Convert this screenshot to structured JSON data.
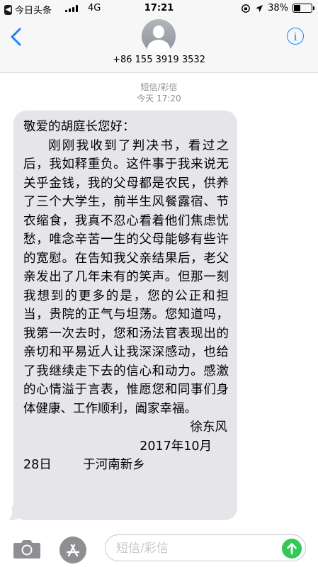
{
  "status_bar": {
    "back_app": "今日头条",
    "network": "4G",
    "time": "17:21",
    "battery": "38%",
    "battery_level": 0.38
  },
  "header": {
    "contact": "+86 155 3919 3532",
    "info_icon": "info-icon"
  },
  "thread": {
    "kind": "短信/彩信",
    "timestamp": "今天 17:20"
  },
  "message": {
    "greeting": "敬爱的胡庭长您好：",
    "body": "刚刚我收到了判决书，看过之后，我如释重负。这件事于我来说无关乎金钱，我的父母都是农民，供养了三个大学生，前半生风餐露宿、节衣缩食，我真不忍心看着他们焦虑忧愁，唯念辛苦一生的父母能够有些许的宽慰。在告知我父亲结果后，老父亲发出了几年未有的笑声。但那一刻我想到的更多的是，您的公正和担当，贵院的正气与坦荡。您知道吗，我第一次去时，您和汤法官表现出的亲切和平易近人让我深深感动，也给了我继续走下去的信心和动力。感激的心情溢于言表，惟愿您和同事们身体健康、工作顺利，阖家幸福。",
    "signature": "徐东风",
    "date_line1": "2017年10月",
    "date_line2": "28日        于河南新乡"
  },
  "composer": {
    "placeholder": "短信/彩信"
  },
  "colors": {
    "accent": "#1a82fb",
    "bubble": "#e5e5ea",
    "send": "#35c759",
    "meta_text": "#8e8e93"
  }
}
